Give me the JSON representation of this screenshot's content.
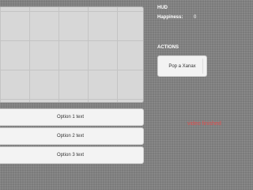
{
  "hud": {
    "title": "HUD",
    "stats": [
      {
        "label": "Happiness:",
        "value": "0"
      }
    ]
  },
  "actions": {
    "title": "ACTIONS",
    "buttons": [
      {
        "label": "Pop a Xanax"
      }
    ]
  },
  "options": [
    {
      "label": "Option 1 text"
    },
    {
      "label": "Option 2 text"
    },
    {
      "label": "Option 3 text"
    }
  ],
  "status": {
    "text": "video finished",
    "color": "#e05050"
  }
}
